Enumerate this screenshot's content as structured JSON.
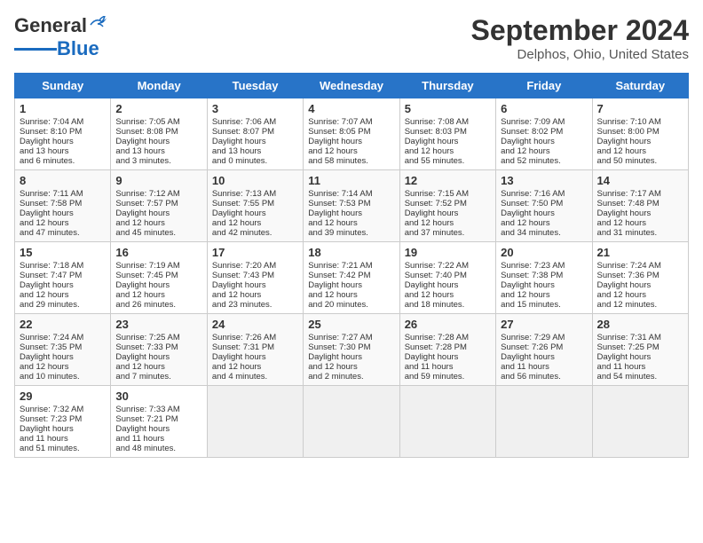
{
  "header": {
    "logo_general": "General",
    "logo_blue": "Blue",
    "month_title": "September 2024",
    "location": "Delphos, Ohio, United States"
  },
  "days_of_week": [
    "Sunday",
    "Monday",
    "Tuesday",
    "Wednesday",
    "Thursday",
    "Friday",
    "Saturday"
  ],
  "weeks": [
    [
      {
        "day": "1",
        "sunrise": "7:04 AM",
        "sunset": "8:10 PM",
        "daylight": "13 hours and 6 minutes."
      },
      {
        "day": "2",
        "sunrise": "7:05 AM",
        "sunset": "8:08 PM",
        "daylight": "13 hours and 3 minutes."
      },
      {
        "day": "3",
        "sunrise": "7:06 AM",
        "sunset": "8:07 PM",
        "daylight": "13 hours and 0 minutes."
      },
      {
        "day": "4",
        "sunrise": "7:07 AM",
        "sunset": "8:05 PM",
        "daylight": "12 hours and 58 minutes."
      },
      {
        "day": "5",
        "sunrise": "7:08 AM",
        "sunset": "8:03 PM",
        "daylight": "12 hours and 55 minutes."
      },
      {
        "day": "6",
        "sunrise": "7:09 AM",
        "sunset": "8:02 PM",
        "daylight": "12 hours and 52 minutes."
      },
      {
        "day": "7",
        "sunrise": "7:10 AM",
        "sunset": "8:00 PM",
        "daylight": "12 hours and 50 minutes."
      }
    ],
    [
      {
        "day": "8",
        "sunrise": "7:11 AM",
        "sunset": "7:58 PM",
        "daylight": "12 hours and 47 minutes."
      },
      {
        "day": "9",
        "sunrise": "7:12 AM",
        "sunset": "7:57 PM",
        "daylight": "12 hours and 45 minutes."
      },
      {
        "day": "10",
        "sunrise": "7:13 AM",
        "sunset": "7:55 PM",
        "daylight": "12 hours and 42 minutes."
      },
      {
        "day": "11",
        "sunrise": "7:14 AM",
        "sunset": "7:53 PM",
        "daylight": "12 hours and 39 minutes."
      },
      {
        "day": "12",
        "sunrise": "7:15 AM",
        "sunset": "7:52 PM",
        "daylight": "12 hours and 37 minutes."
      },
      {
        "day": "13",
        "sunrise": "7:16 AM",
        "sunset": "7:50 PM",
        "daylight": "12 hours and 34 minutes."
      },
      {
        "day": "14",
        "sunrise": "7:17 AM",
        "sunset": "7:48 PM",
        "daylight": "12 hours and 31 minutes."
      }
    ],
    [
      {
        "day": "15",
        "sunrise": "7:18 AM",
        "sunset": "7:47 PM",
        "daylight": "12 hours and 29 minutes."
      },
      {
        "day": "16",
        "sunrise": "7:19 AM",
        "sunset": "7:45 PM",
        "daylight": "12 hours and 26 minutes."
      },
      {
        "day": "17",
        "sunrise": "7:20 AM",
        "sunset": "7:43 PM",
        "daylight": "12 hours and 23 minutes."
      },
      {
        "day": "18",
        "sunrise": "7:21 AM",
        "sunset": "7:42 PM",
        "daylight": "12 hours and 20 minutes."
      },
      {
        "day": "19",
        "sunrise": "7:22 AM",
        "sunset": "7:40 PM",
        "daylight": "12 hours and 18 minutes."
      },
      {
        "day": "20",
        "sunrise": "7:23 AM",
        "sunset": "7:38 PM",
        "daylight": "12 hours and 15 minutes."
      },
      {
        "day": "21",
        "sunrise": "7:24 AM",
        "sunset": "7:36 PM",
        "daylight": "12 hours and 12 minutes."
      }
    ],
    [
      {
        "day": "22",
        "sunrise": "7:24 AM",
        "sunset": "7:35 PM",
        "daylight": "12 hours and 10 minutes."
      },
      {
        "day": "23",
        "sunrise": "7:25 AM",
        "sunset": "7:33 PM",
        "daylight": "12 hours and 7 minutes."
      },
      {
        "day": "24",
        "sunrise": "7:26 AM",
        "sunset": "7:31 PM",
        "daylight": "12 hours and 4 minutes."
      },
      {
        "day": "25",
        "sunrise": "7:27 AM",
        "sunset": "7:30 PM",
        "daylight": "12 hours and 2 minutes."
      },
      {
        "day": "26",
        "sunrise": "7:28 AM",
        "sunset": "7:28 PM",
        "daylight": "11 hours and 59 minutes."
      },
      {
        "day": "27",
        "sunrise": "7:29 AM",
        "sunset": "7:26 PM",
        "daylight": "11 hours and 56 minutes."
      },
      {
        "day": "28",
        "sunrise": "7:31 AM",
        "sunset": "7:25 PM",
        "daylight": "11 hours and 54 minutes."
      }
    ],
    [
      {
        "day": "29",
        "sunrise": "7:32 AM",
        "sunset": "7:23 PM",
        "daylight": "11 hours and 51 minutes."
      },
      {
        "day": "30",
        "sunrise": "7:33 AM",
        "sunset": "7:21 PM",
        "daylight": "11 hours and 48 minutes."
      },
      null,
      null,
      null,
      null,
      null
    ]
  ],
  "labels": {
    "sunrise": "Sunrise:",
    "sunset": "Sunset:",
    "daylight": "Daylight hours"
  }
}
